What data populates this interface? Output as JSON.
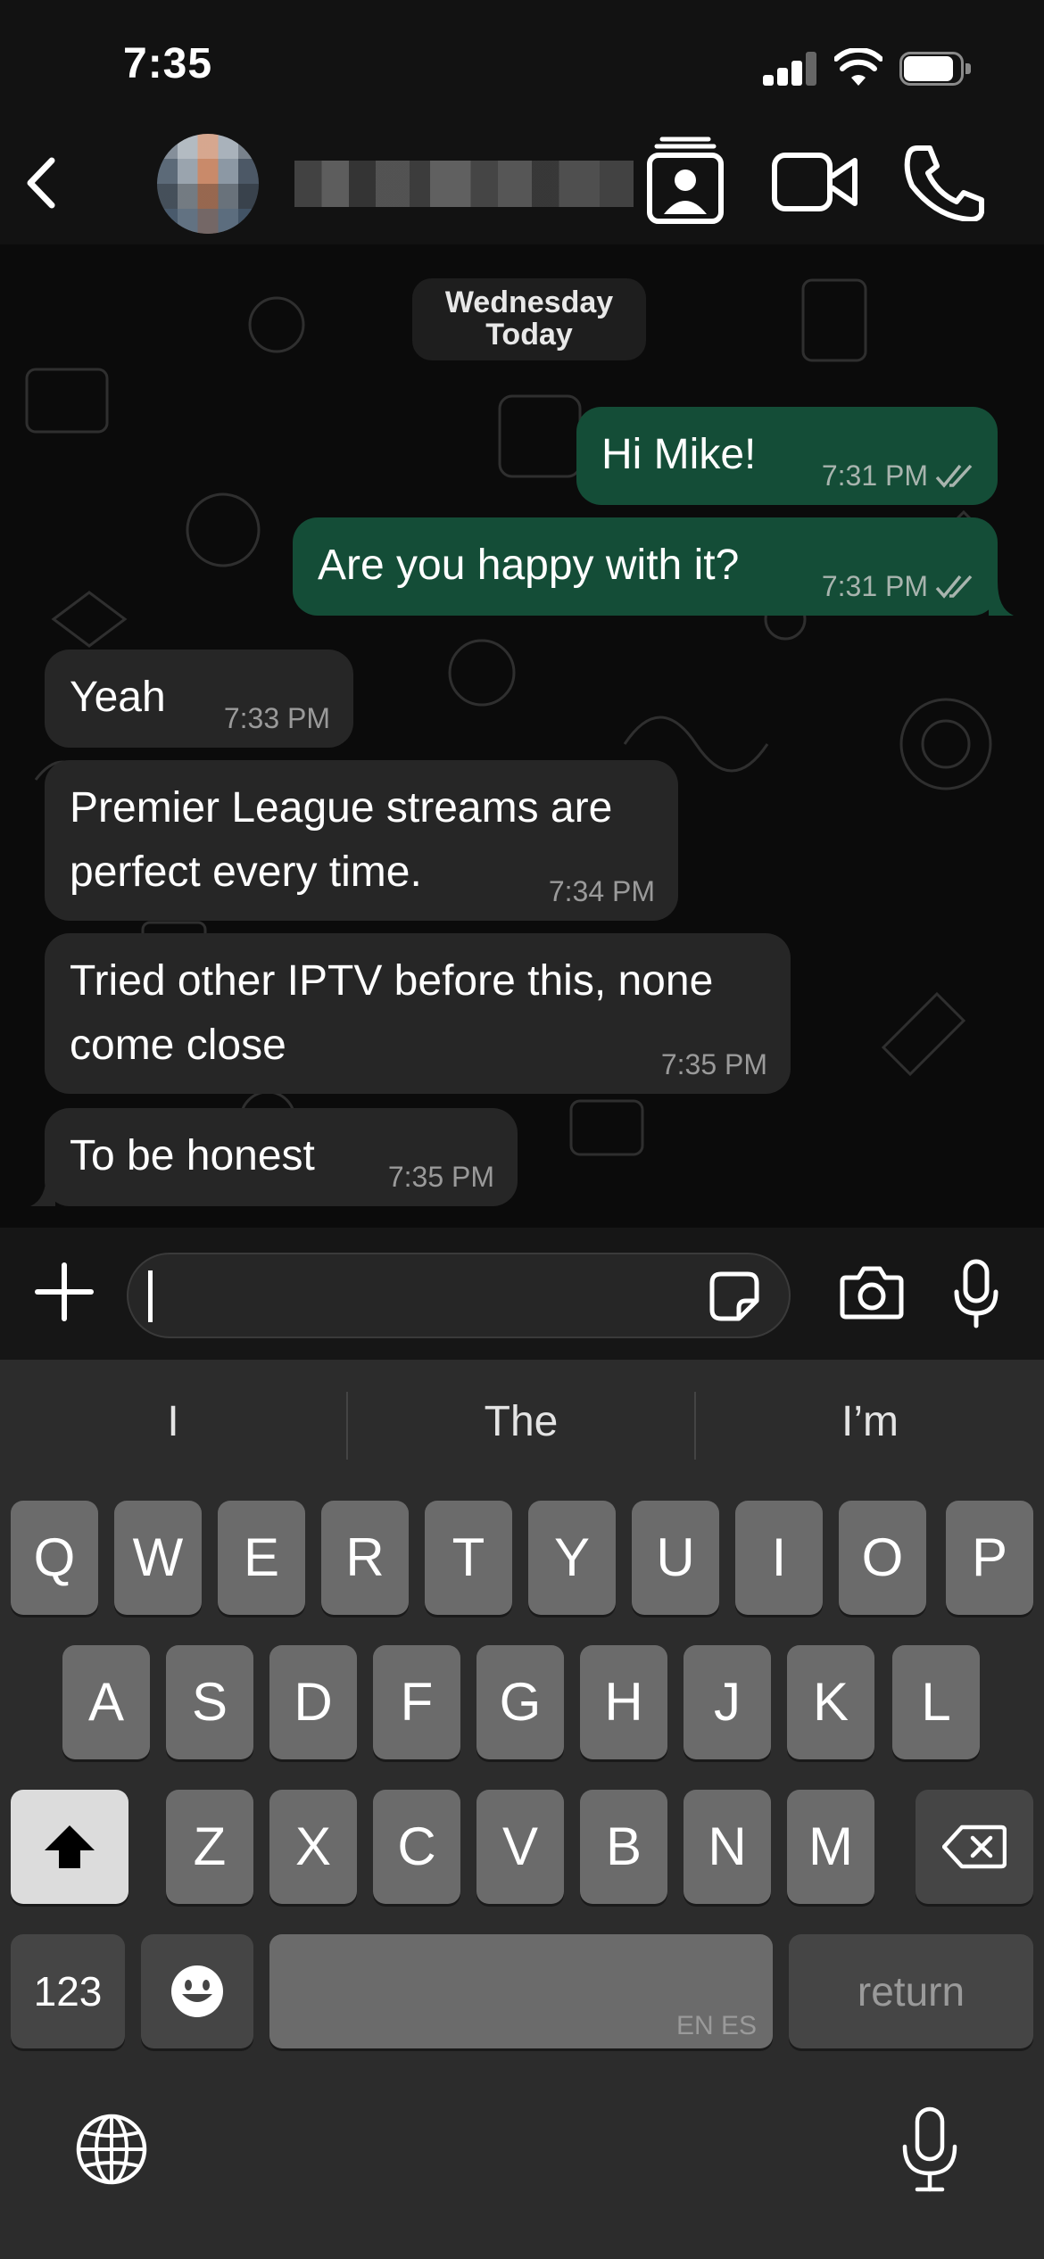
{
  "status_bar": {
    "time": "7:35",
    "icons": [
      "cellular-signal-icon",
      "wifi-icon",
      "battery-icon"
    ]
  },
  "header": {
    "back_icon": "chevron-left-icon",
    "contact_name": "",
    "actions": [
      "contact-card-icon",
      "video-call-icon",
      "phone-icon"
    ]
  },
  "chat": {
    "date_chip": {
      "line1": "Wednesday",
      "line2": "Today"
    },
    "messages": [
      {
        "direction": "out",
        "text": "Hi Mike!",
        "time": "7:31 PM",
        "status": "read-double-check-icon"
      },
      {
        "direction": "out",
        "text": "Are you happy with it?",
        "time": "7:31 PM",
        "status": "read-double-check-icon"
      },
      {
        "direction": "in",
        "text": "Yeah",
        "time": "7:33 PM"
      },
      {
        "direction": "in",
        "text_line1": "Premier League streams are",
        "text_line2": "perfect every time.",
        "time": "7:34 PM"
      },
      {
        "direction": "in",
        "text_line1": "Tried other IPTV before this, none",
        "text_line2": "come close",
        "time": "7:35 PM"
      },
      {
        "direction": "in",
        "text": "To be honest",
        "time": "7:35 PM"
      }
    ]
  },
  "input_bar": {
    "plus_icon": "plus-icon",
    "message_value": "",
    "sticker_icon": "sticker-icon",
    "camera_icon": "camera-icon",
    "mic_icon": "microphone-icon"
  },
  "keyboard": {
    "suggestions": [
      "I",
      "The",
      "I’m"
    ],
    "row1": [
      "Q",
      "W",
      "E",
      "R",
      "T",
      "Y",
      "U",
      "I",
      "O",
      "P"
    ],
    "row2": [
      "A",
      "S",
      "D",
      "F",
      "G",
      "H",
      "J",
      "K",
      "L"
    ],
    "row3": [
      "Z",
      "X",
      "C",
      "V",
      "B",
      "N",
      "M"
    ],
    "numbers_label": "123",
    "space_lang": "EN ES",
    "return_label": "return",
    "shift_icon": "shift-icon",
    "delete_icon": "backspace-icon",
    "emoji_icon": "emoji-icon",
    "globe_icon": "globe-icon",
    "dictation_icon": "microphone-icon"
  },
  "colors": {
    "outgoing_bubble": "#144d37",
    "incoming_bubble": "#262626",
    "chat_background": "#0b0b0b",
    "keyboard_background": "#2c2c2c"
  }
}
